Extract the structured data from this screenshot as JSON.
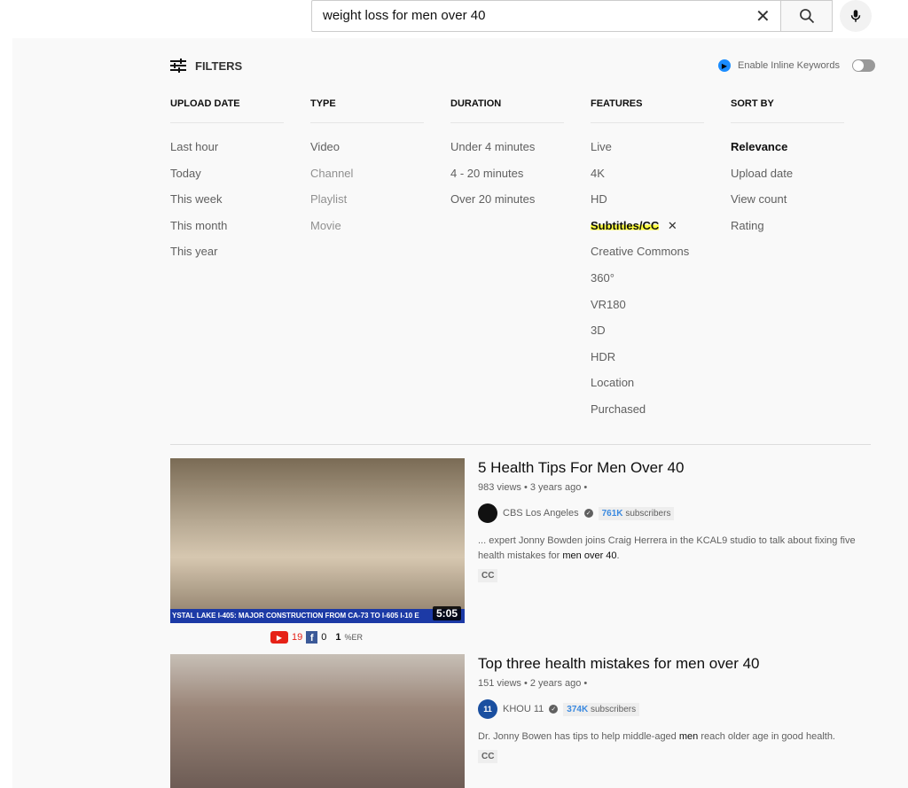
{
  "search": {
    "value": "weight loss for men over 40",
    "clear_icon": "close-icon",
    "search_icon": "search-icon",
    "mic_icon": "mic-icon"
  },
  "filters": {
    "label": "FILTERS",
    "icon": "sliders-icon",
    "inline_keywords_label": "Enable Inline Keywords",
    "inline_keywords_enabled": false,
    "columns": [
      {
        "header": "UPLOAD DATE",
        "items": [
          "Last hour",
          "Today",
          "This week",
          "This month",
          "This year"
        ]
      },
      {
        "header": "TYPE",
        "items": [
          "Video",
          "Channel",
          "Playlist",
          "Movie"
        ]
      },
      {
        "header": "DURATION",
        "items": [
          "Under 4 minutes",
          "4 - 20 minutes",
          "Over 20 minutes"
        ]
      },
      {
        "header": "FEATURES",
        "items": [
          "Live",
          "4K",
          "HD",
          "Subtitles/CC",
          "Creative Commons",
          "360°",
          "VR180",
          "3D",
          "HDR",
          "Location",
          "Purchased"
        ]
      },
      {
        "header": "SORT BY",
        "items": [
          "Relevance",
          "Upload date",
          "View count",
          "Rating"
        ]
      }
    ],
    "selected_feature": "Subtitles/CC",
    "selected_sort": "Relevance"
  },
  "results": [
    {
      "title": "5 Health Tips For Men Over 40",
      "meta": "983 views • 3 years ago •",
      "channel": "CBS Los Angeles",
      "subs_count": "761K",
      "subs_label": "subscribers",
      "desc_pre": "... expert Jonny Bowden joins Craig Herrera in the KCAL9 studio to talk about fixing five health mistakes for ",
      "desc_bold": "men over 40",
      "desc_post": ".",
      "badge": "CC",
      "duration": "5:05",
      "ticker": "YSTAL LAKE  I-405: MAJOR CONSTRUCTION FROM CA-73 TO I-605  I-10 E",
      "stats": {
        "yt": "19",
        "fb": "0",
        "er": "1",
        "er_label": "%ER"
      }
    },
    {
      "title": "Top three health mistakes for men over 40",
      "meta": "151 views • 2 years ago •",
      "channel": "KHOU 11",
      "subs_count": "374K",
      "subs_label": "subscribers",
      "desc_pre": "Dr. Jonny Bowen has tips to help middle-aged ",
      "desc_bold": "men",
      "desc_post": " reach older age in good health.",
      "badge": "CC"
    }
  ]
}
